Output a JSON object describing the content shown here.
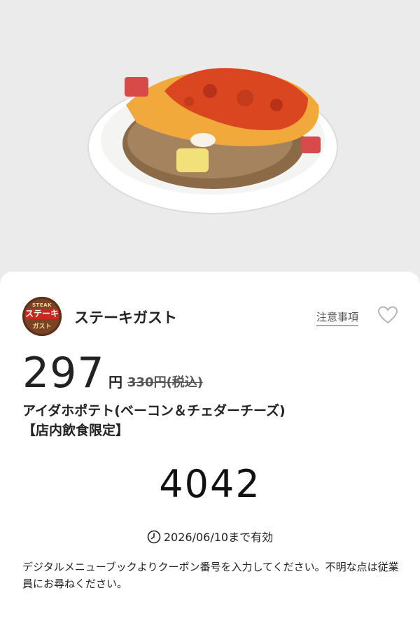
{
  "hero": {
    "image_alt": "baked-potato-photo"
  },
  "brand": {
    "logo_top": "STEAK",
    "logo_mid": "ステーキ",
    "logo_bottom": "ガスト",
    "name": "ステーキガスト"
  },
  "actions": {
    "notice_label": "注意事項",
    "favorite_icon": "heart-outline-icon"
  },
  "coupon": {
    "price": "297",
    "currency": "円",
    "original_price": "330円(税込)",
    "item_name": "アイダホポテト(ベーコン＆チェダーチーズ)",
    "item_note": "【店内飲食限定】",
    "code": "4042",
    "expiry": "2026/06/10まで有効",
    "instructions": "デジタルメニューブックよりクーポン番号を入力してください。不明な点は従業員にお尋ねください。"
  },
  "colors": {
    "background": "#ebebeb",
    "card": "#ffffff",
    "logo_brown": "#7a4424",
    "logo_red": "#c8281e"
  }
}
